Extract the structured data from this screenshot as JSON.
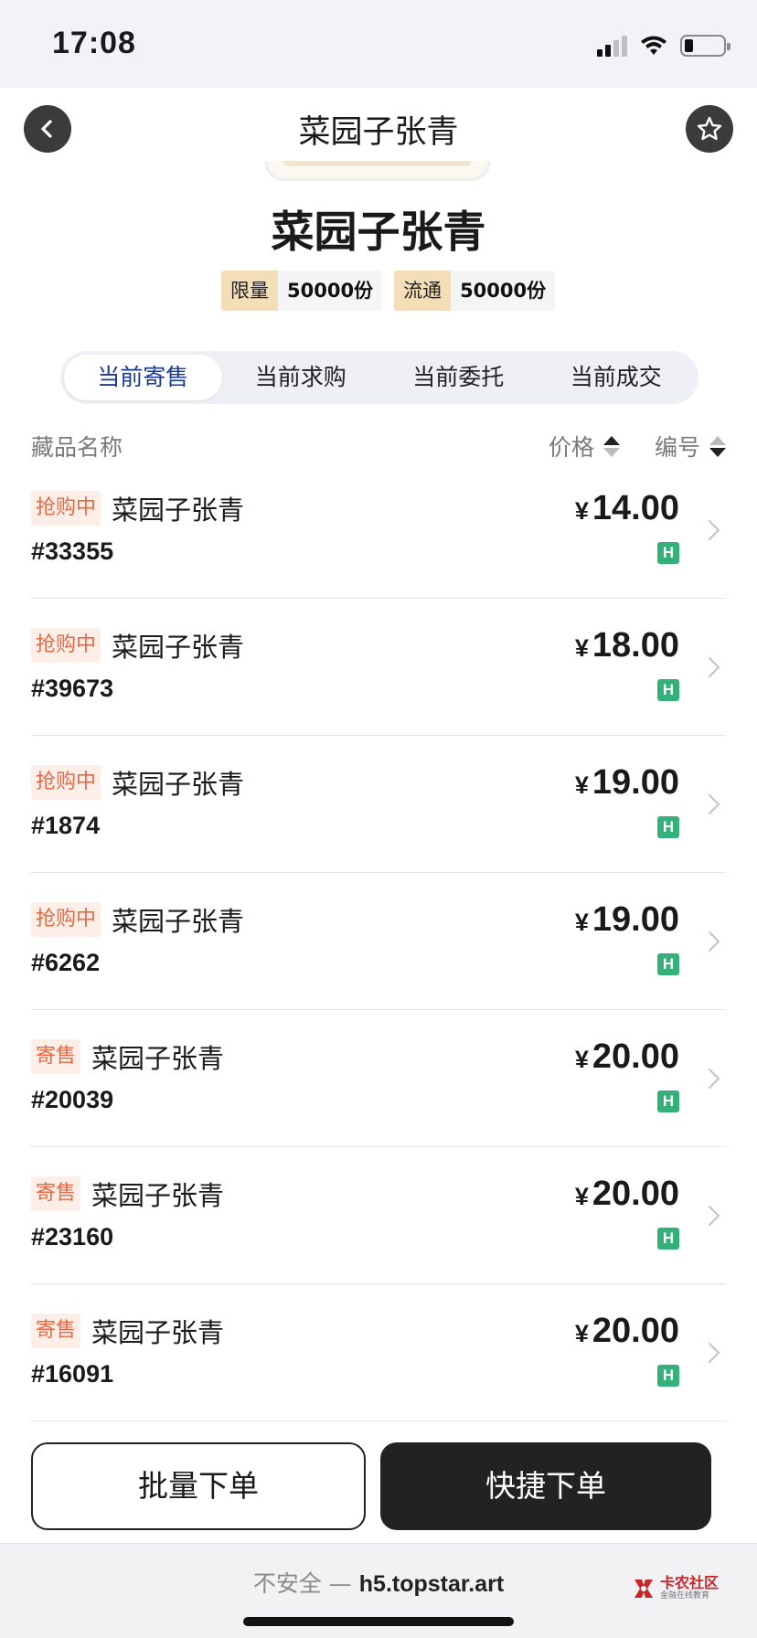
{
  "status_bar": {
    "time": "17:08"
  },
  "header": {
    "title": "菜园子张青"
  },
  "item": {
    "title": "菜园子张青",
    "stats": [
      {
        "label": "限量",
        "value": "50000份"
      },
      {
        "label": "流通",
        "value": "50000份"
      }
    ]
  },
  "tabs": [
    {
      "label": "当前寄售",
      "active": true
    },
    {
      "label": "当前求购",
      "active": false
    },
    {
      "label": "当前委托",
      "active": false
    },
    {
      "label": "当前成交",
      "active": false
    }
  ],
  "list_header": {
    "name": "藏品名称",
    "price": "价格",
    "number": "编号"
  },
  "currency_symbol": "¥",
  "chain_badge": "H",
  "listings": [
    {
      "tag": "抢购中",
      "name": "菜园子张青",
      "serial": "#33355",
      "price": "14.00"
    },
    {
      "tag": "抢购中",
      "name": "菜园子张青",
      "serial": "#39673",
      "price": "18.00"
    },
    {
      "tag": "抢购中",
      "name": "菜园子张青",
      "serial": "#1874",
      "price": "19.00"
    },
    {
      "tag": "抢购中",
      "name": "菜园子张青",
      "serial": "#6262",
      "price": "19.00"
    },
    {
      "tag": "寄售",
      "name": "菜园子张青",
      "serial": "#20039",
      "price": "20.00"
    },
    {
      "tag": "寄售",
      "name": "菜园子张青",
      "serial": "#23160",
      "price": "20.00"
    },
    {
      "tag": "寄售",
      "name": "菜园子张青",
      "serial": "#16091",
      "price": "20.00"
    }
  ],
  "actions": {
    "batch_order": "批量下单",
    "quick_order": "快捷下单"
  },
  "browser": {
    "insecure_label": "不安全 — ",
    "host": "h5.topstar.art"
  },
  "watermark": {
    "main": "卡农社区",
    "sub": "金融在线教育"
  },
  "colors": {
    "accent_tab": "#1b3a8c",
    "tag_text": "#e36a45",
    "tag_bg": "#fdeee7",
    "chain_green": "#35b07a",
    "stat_label_bg": "#f3deb8"
  },
  "icons": {
    "back": "chevron-left-icon",
    "favorite": "star-icon",
    "row_arrow": "chevron-right-icon"
  }
}
